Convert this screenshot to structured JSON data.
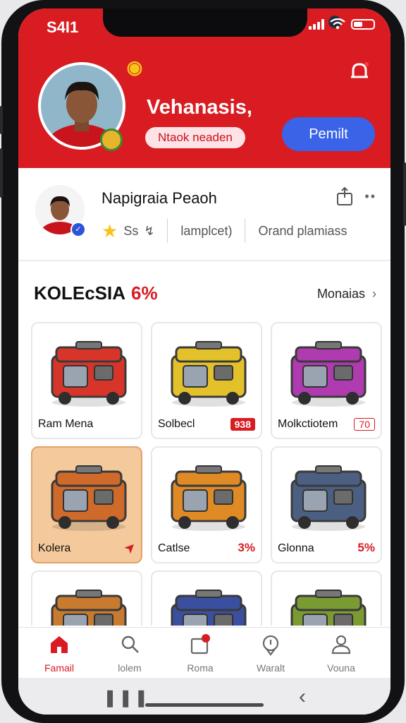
{
  "status_bar": {
    "time": "S4I1"
  },
  "header": {
    "username": "Vehanasis,",
    "tag": "Ntaok neaden",
    "cta_label": "Pemilt",
    "accent": "#d81c22",
    "cta_color": "#3a63e8"
  },
  "profile": {
    "name": "Napigraia Peaoh",
    "stat_a": "Ss",
    "stat_b": "lamplcet)",
    "stat_c": "Orand plamiass"
  },
  "section": {
    "title": "KOLEcSIA",
    "percent": "6%",
    "more_label": "Monaias"
  },
  "collection": [
    {
      "name": "Ram Mena",
      "tag": "",
      "tag_style": "none",
      "color": "#d8352a"
    },
    {
      "name": "Solbecl",
      "tag": "938",
      "tag_style": "boxred",
      "color": "#e3c12b"
    },
    {
      "name": "Molkctiotem",
      "tag": "70",
      "tag_style": "outline",
      "color": "#b03ab0"
    },
    {
      "name": "Kolera",
      "tag": "",
      "tag_style": "arrow",
      "color": "#d06a2a",
      "selected": true
    },
    {
      "name": "Catlse",
      "tag": "3%",
      "tag_style": "text",
      "color": "#e08a25"
    },
    {
      "name": "Glonna",
      "tag": "5%",
      "tag_style": "text",
      "color": "#4b5f82"
    },
    {
      "name": "",
      "tag": "",
      "tag_style": "none",
      "color": "#c87a2e"
    },
    {
      "name": "",
      "tag": "",
      "tag_style": "none",
      "color": "#3a4fa0"
    },
    {
      "name": "",
      "tag": "",
      "tag_style": "none",
      "color": "#7a9a32"
    }
  ],
  "tabs": [
    {
      "label": "Famail",
      "icon": "home-icon",
      "active": true
    },
    {
      "label": "lolem",
      "icon": "search-icon",
      "active": false
    },
    {
      "label": "Roma",
      "icon": "inbox-icon",
      "active": false
    },
    {
      "label": "Waralt",
      "icon": "location-icon",
      "active": false
    },
    {
      "label": "Vouna",
      "icon": "profile-icon",
      "active": false
    }
  ]
}
